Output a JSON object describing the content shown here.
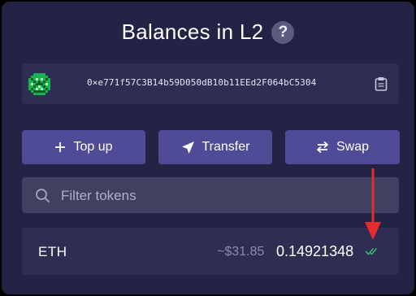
{
  "header": {
    "title": "Balances in L2",
    "help_icon": "question-mark-icon"
  },
  "account": {
    "address": "0×e771f57C3B14b59D050dB10b11EEd2F064bC5304",
    "avatar_icon": "identicon",
    "copy_icon": "clipboard-icon"
  },
  "actions": {
    "top_up_label": "Top up",
    "top_up_icon": "plus-icon",
    "transfer_label": "Transfer",
    "transfer_icon": "send-arrow-icon",
    "swap_label": "Swap",
    "swap_icon": "swap-arrows-icon"
  },
  "filter": {
    "placeholder": "Filter tokens",
    "value": "",
    "icon": "search-icon"
  },
  "tokens": [
    {
      "symbol": "ETH",
      "usd_value": "~$31.85",
      "amount": "0.14921348",
      "status_icon": "double-check-icon"
    }
  ],
  "colors": {
    "background": "#242345",
    "card": "#2e2d52",
    "button": "#504b96",
    "input": "#424060",
    "accent_green": "#2fbf71",
    "annotation_red": "#e52b2b"
  }
}
